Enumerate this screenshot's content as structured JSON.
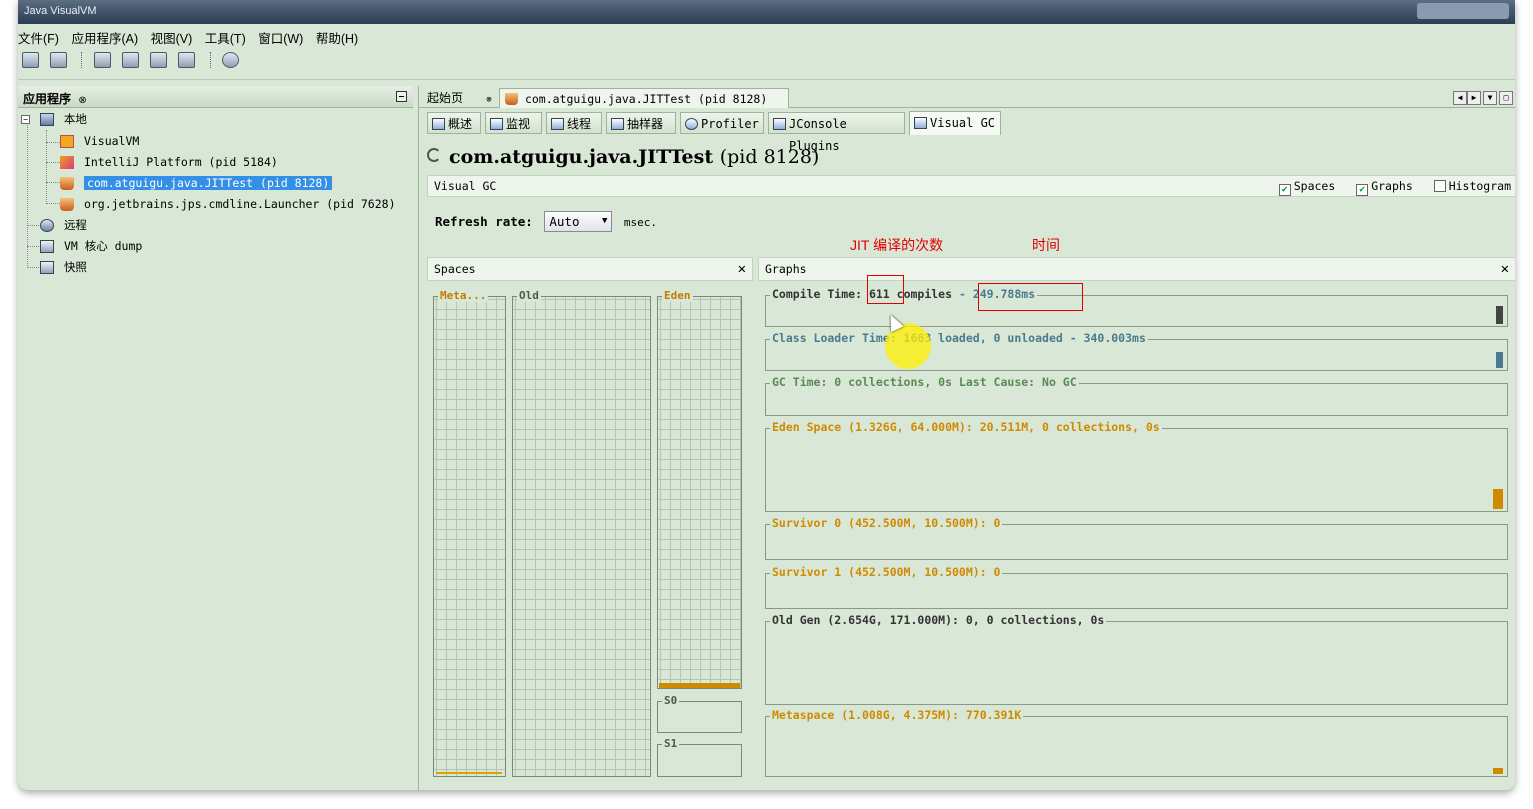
{
  "window": {
    "title": "Java VisualVM"
  },
  "menu": [
    "文件(F)",
    "应用程序(A)",
    "视图(V)",
    "工具(T)",
    "窗口(W)",
    "帮助(H)"
  ],
  "left_panel": {
    "title": "应用程序",
    "close": "⊗",
    "tree": {
      "local": "本地",
      "visualvm": "VisualVM",
      "intellij": "IntelliJ Platform (pid 5184)",
      "jittest": "com.atguigu.java.JITTest (pid 8128)",
      "launcher": "org.jetbrains.jps.cmdline.Launcher (pid 7628)",
      "remote": "远程",
      "coredump": "VM 核心 dump",
      "snapshot": "快照"
    }
  },
  "doc_tabs": {
    "start": "起始页",
    "app": "com.atguigu.java.JITTest (pid 8128)",
    "close": "⊗"
  },
  "sub_tabs": [
    "概述",
    "监视",
    "线程",
    "抽样器",
    "Profiler",
    "JConsole Plugins",
    "Visual GC"
  ],
  "app_header": {
    "name": "com.atguigu.java.JITTest",
    "pid": "(pid 8128)"
  },
  "visual_gc": {
    "label": "Visual GC",
    "checks": [
      {
        "label": "Spaces",
        "checked": true
      },
      {
        "label": "Graphs",
        "checked": true
      },
      {
        "label": "Histogram",
        "checked": false
      }
    ]
  },
  "refresh": {
    "label": "Refresh rate:",
    "value": "Auto",
    "unit": "msec."
  },
  "annotations": {
    "compiles": "JIT 编译的次数",
    "time": "时间"
  },
  "spaces_panel": {
    "title": "Spaces",
    "labels": {
      "metaspace": "Meta...",
      "old": "Old",
      "eden": "Eden",
      "s0": "S0",
      "s1": "S1"
    }
  },
  "graphs_panel": {
    "title": "Graphs",
    "compile_prefix": "Compile Time: ",
    "compile_count": "611",
    "compile_mid": " compiles ",
    "compile_time": "- 249.788ms",
    "class_loader": "Class Loader Time: 1663 loaded, 0 unloaded - 340.003ms",
    "gc_time": "GC Time: 0 collections, 0s Last Cause: No GC",
    "eden": "Eden Space (1.326G, 64.000M): 20.511M, 0 collections, 0s",
    "survivor0": "Survivor 0 (452.500M, 10.500M): 0",
    "survivor1": "Survivor 1 (452.500M, 10.500M): 0",
    "old_gen": "Old Gen (2.654G, 171.000M): 0, 0 collections, 0s",
    "metaspace": "Metaspace (1.008G, 4.375M): 770.391K"
  },
  "colors": {
    "panel_bg": "#d9e8d6",
    "selection": "#3390e6",
    "annotation": "#e00000",
    "space_label": "#c87a00"
  }
}
